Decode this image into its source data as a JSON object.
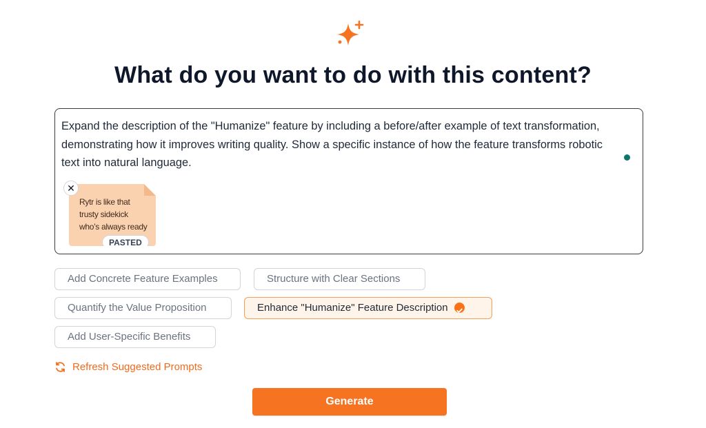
{
  "colors": {
    "accent": "#f57321",
    "dot": "#0f766e"
  },
  "header": {
    "logo_icon": "sparkle-icon",
    "title": "What do you want to do with this content?"
  },
  "editor": {
    "text": "Expand the description of the \"Humanize\" feature by including a before/after example of text transformation, demonstrating how it improves writing quality. Show a specific instance of how the feature transforms robotic text into natural language.",
    "pasted": {
      "preview": "Rytr is like that trusty sidekick who’s always ready",
      "badge": "PASTED",
      "remove_icon": "close-icon"
    }
  },
  "suggestions": [
    {
      "label": "Add Concrete Feature Examples",
      "selected": false
    },
    {
      "label": "Structure with Clear Sections",
      "selected": false
    },
    {
      "label": "Quantify the Value Proposition",
      "selected": false
    },
    {
      "label": "Enhance \"Humanize\" Feature Description",
      "selected": true
    },
    {
      "label": "Add User-Specific Benefits",
      "selected": false
    }
  ],
  "refresh": {
    "label": "Refresh Suggested Prompts",
    "icon": "refresh-icon"
  },
  "generate": {
    "label": "Generate"
  }
}
